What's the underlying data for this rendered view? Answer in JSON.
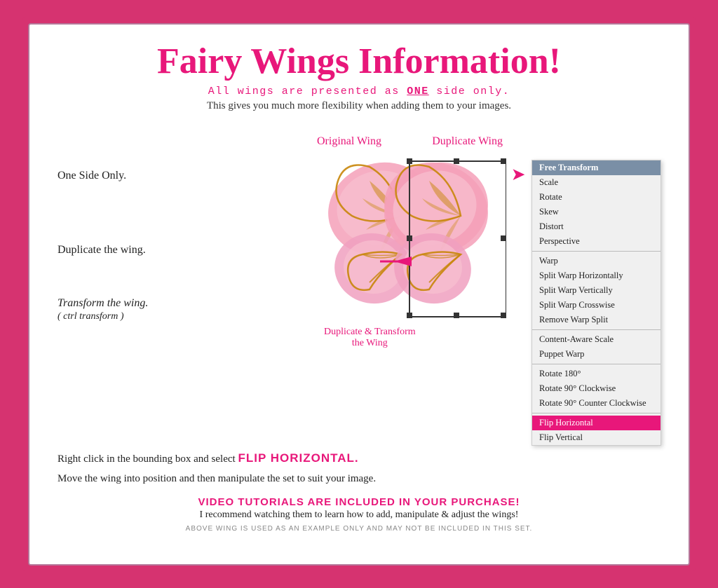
{
  "page": {
    "title": "Fairy Wings Information!",
    "subtitle": "All wings are presented as ONE side only.",
    "description": "This gives you much more flexibility when adding them to your images.",
    "steps": {
      "step1": "One Side Only.",
      "step2": "Duplicate the wing.",
      "step3_line1": "Transform the wing.",
      "step3_line2": "( ctrl transform )",
      "label_original": "Original Wing",
      "label_duplicate": "Duplicate Wing",
      "dup_label": "Duplicate & Transform\nthe Wing"
    },
    "flip_text_prefix": "Right click in the bounding box and select",
    "flip_text_highlight": "FLIP HORIZONTAL.",
    "move_text": "Move the wing into position and then manipulate the set to suit your image.",
    "video_title": "VIDEO TUTORIALS ARE INCLUDED IN YOUR PURCHASE!",
    "video_sub": "I recommend watching them to learn how to add, manipulate & adjust the wings!",
    "disclaimer": "ABOVE WING IS USED AS AN EXAMPLE ONLY AND MAY NOT BE INCLUDED IN THIS SET.",
    "context_menu": {
      "items": [
        {
          "label": "Free Transform",
          "type": "active"
        },
        {
          "label": "",
          "type": "divider-after-header"
        },
        {
          "label": "Scale",
          "type": "normal"
        },
        {
          "label": "Rotate",
          "type": "normal"
        },
        {
          "label": "Skew",
          "type": "normal"
        },
        {
          "label": "Distort",
          "type": "normal"
        },
        {
          "label": "Perspective",
          "type": "normal"
        },
        {
          "label": "",
          "type": "divider"
        },
        {
          "label": "Warp",
          "type": "normal"
        },
        {
          "label": "Split Warp Horizontally",
          "type": "normal"
        },
        {
          "label": "Split Warp Vertically",
          "type": "normal"
        },
        {
          "label": "Split Warp Crosswise",
          "type": "normal"
        },
        {
          "label": "Remove Warp Split",
          "type": "normal"
        },
        {
          "label": "",
          "type": "divider"
        },
        {
          "label": "Content-Aware Scale",
          "type": "normal"
        },
        {
          "label": "Puppet Warp",
          "type": "normal"
        },
        {
          "label": "",
          "type": "divider"
        },
        {
          "label": "Rotate 180°",
          "type": "normal"
        },
        {
          "label": "Rotate 90° Clockwise",
          "type": "normal"
        },
        {
          "label": "Rotate 90° Counter Clockwise",
          "type": "normal"
        },
        {
          "label": "",
          "type": "divider"
        },
        {
          "label": "Flip Horizontal",
          "type": "highlighted"
        },
        {
          "label": "Flip Vertical",
          "type": "normal"
        }
      ]
    }
  }
}
